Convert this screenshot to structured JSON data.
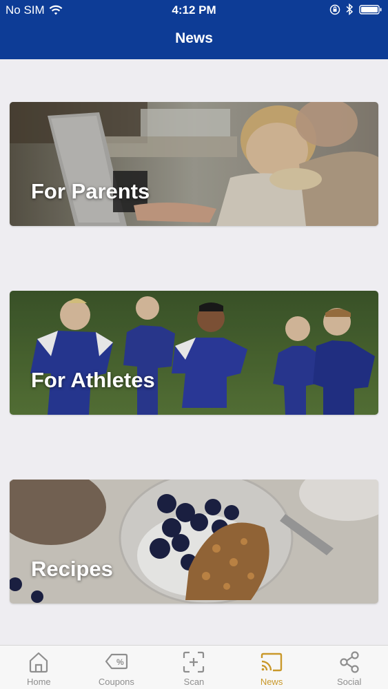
{
  "status_bar": {
    "carrier": "No SIM",
    "time": "4:12 PM"
  },
  "header": {
    "title": "News"
  },
  "cards": [
    {
      "label": "For Parents",
      "image": "parent-child-laptop-photo"
    },
    {
      "label": "For Athletes",
      "image": "youth-soccer-players-photo"
    },
    {
      "label": "Recipes",
      "image": "yogurt-granola-blueberries-photo"
    }
  ],
  "tabs": [
    {
      "label": "Home",
      "icon": "home-icon",
      "active": false
    },
    {
      "label": "Coupons",
      "icon": "coupon-tag-icon",
      "active": false
    },
    {
      "label": "Scan",
      "icon": "scan-icon",
      "active": false
    },
    {
      "label": "News",
      "icon": "cast-news-icon",
      "active": true
    },
    {
      "label": "Social",
      "icon": "share-icon",
      "active": false
    }
  ],
  "colors": {
    "header_bg": "#0d3c96",
    "active_tab": "#c9982a",
    "inactive_tab": "#8e8e8e",
    "page_bg": "#eeedf1"
  }
}
